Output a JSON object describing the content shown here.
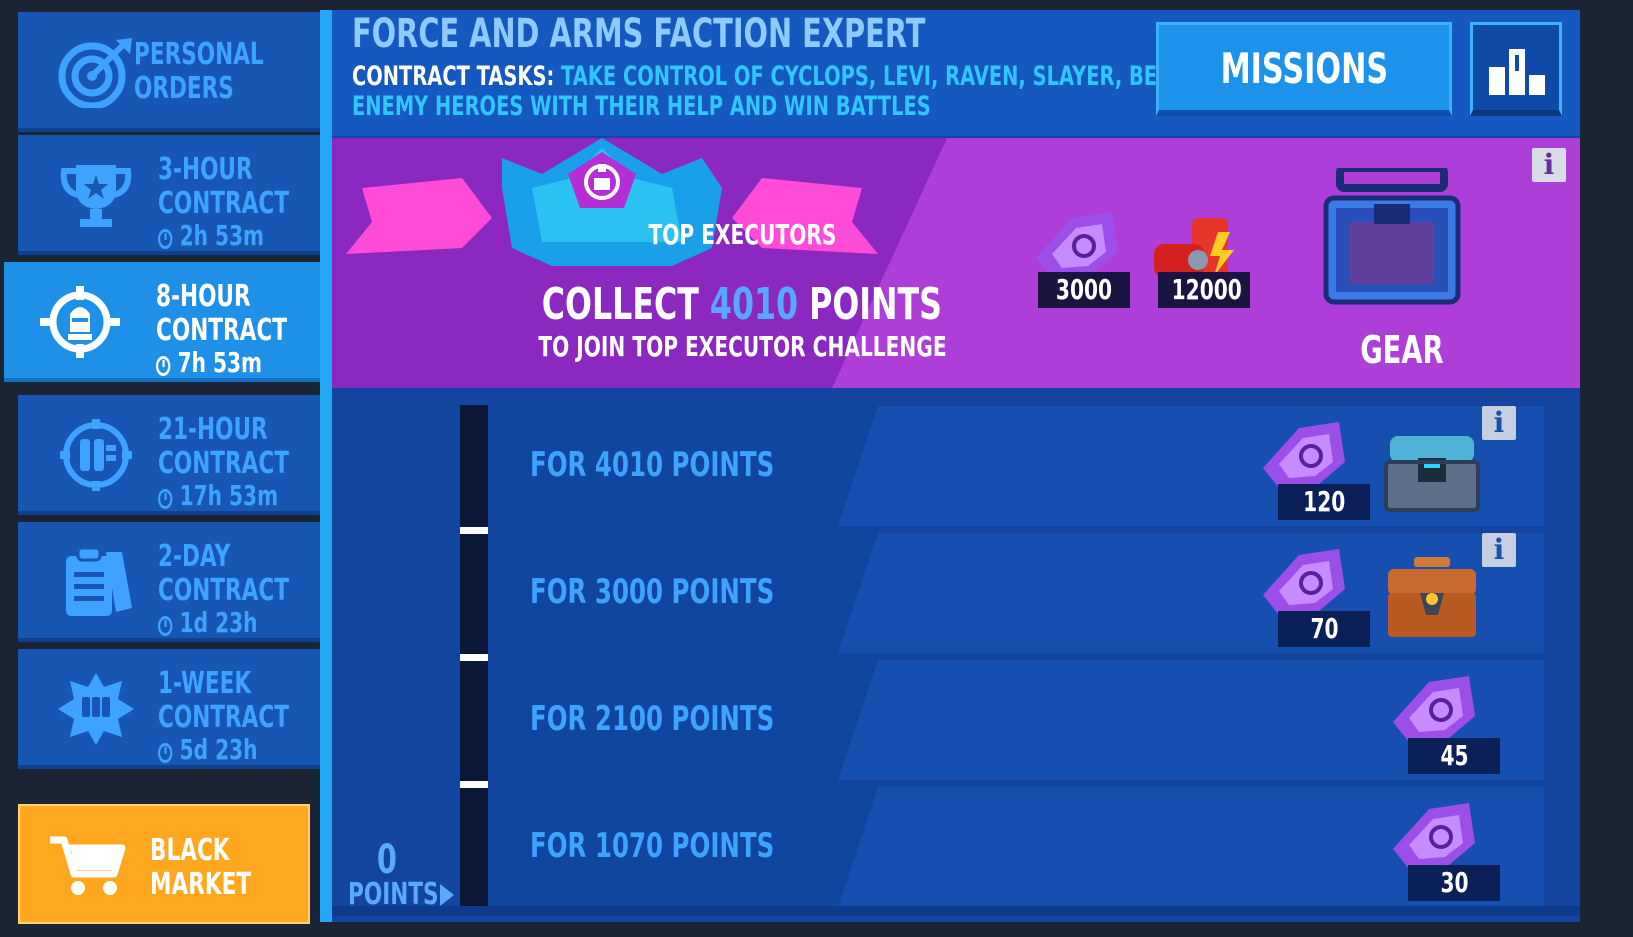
{
  "sidebar": {
    "items": [
      {
        "line1": "PERSONAL",
        "line2": "ORDERS",
        "icon": "target-icon"
      },
      {
        "line1": "3-HOUR",
        "line2": "CONTRACT",
        "timer": "2h 53m",
        "icon": "trophy-icon"
      },
      {
        "line1": "8-HOUR",
        "line2": "CONTRACT",
        "timer": "7h 53m",
        "icon": "crosshair-icon",
        "active": true
      },
      {
        "line1": "21-HOUR",
        "line2": "CONTRACT",
        "timer": "17h 53m",
        "icon": "fist-emblem-icon"
      },
      {
        "line1": "2-DAY",
        "line2": "CONTRACT",
        "timer": "1d 23h",
        "icon": "clipboard-icon"
      },
      {
        "line1": "1-WEEK",
        "line2": "CONTRACT",
        "timer": "5d 23h",
        "icon": "star-fist-icon"
      }
    ],
    "market": {
      "line1": "BLACK",
      "line2": "MARKET",
      "icon": "cart-icon"
    }
  },
  "header": {
    "title": "FORCE AND ARMS FACTION EXPERT",
    "tasks_prefix": "CONTRACT TASKS: ",
    "tasks_text": "TAKE CONTROL OF CYCLOPS, LEVI, RAVEN, SLAYER, BERTHA OR LYNX. DESTROY ENEMY HEROES WITH THEIR HELP AND WIN BATTLES",
    "missions_label": "MISSIONS"
  },
  "banner": {
    "badge_text": "TOP EXECUTORS",
    "collect_prefix": "COLLECT ",
    "collect_points": "4010",
    "collect_suffix": " POINTS",
    "subtitle": "TO JOIN TOP EXECUTOR CHALLENGE",
    "rewards": [
      {
        "icon": "key-token-icon",
        "amount": "3000"
      },
      {
        "icon": "fuel-cans-icon",
        "amount": "12000"
      }
    ],
    "gear_label": "GEAR",
    "info": "i"
  },
  "tiers": [
    {
      "label": "FOR 4010 POINTS",
      "key_amount": "120",
      "chest": "steel-chest-icon",
      "info": "i"
    },
    {
      "label": "FOR 3000 POINTS",
      "key_amount": "70",
      "chest": "wood-chest-icon",
      "info": "i"
    },
    {
      "label": "FOR 2100 POINTS",
      "key_amount": "45"
    },
    {
      "label": "FOR 1070 POINTS",
      "key_amount": "30"
    }
  ],
  "progress": {
    "points": "0",
    "label": "POINTS"
  },
  "colors": {
    "accent": "#23a8f5",
    "banner": "#ad3fd8",
    "market": "#ffa81f",
    "panel": "#1345a0"
  }
}
